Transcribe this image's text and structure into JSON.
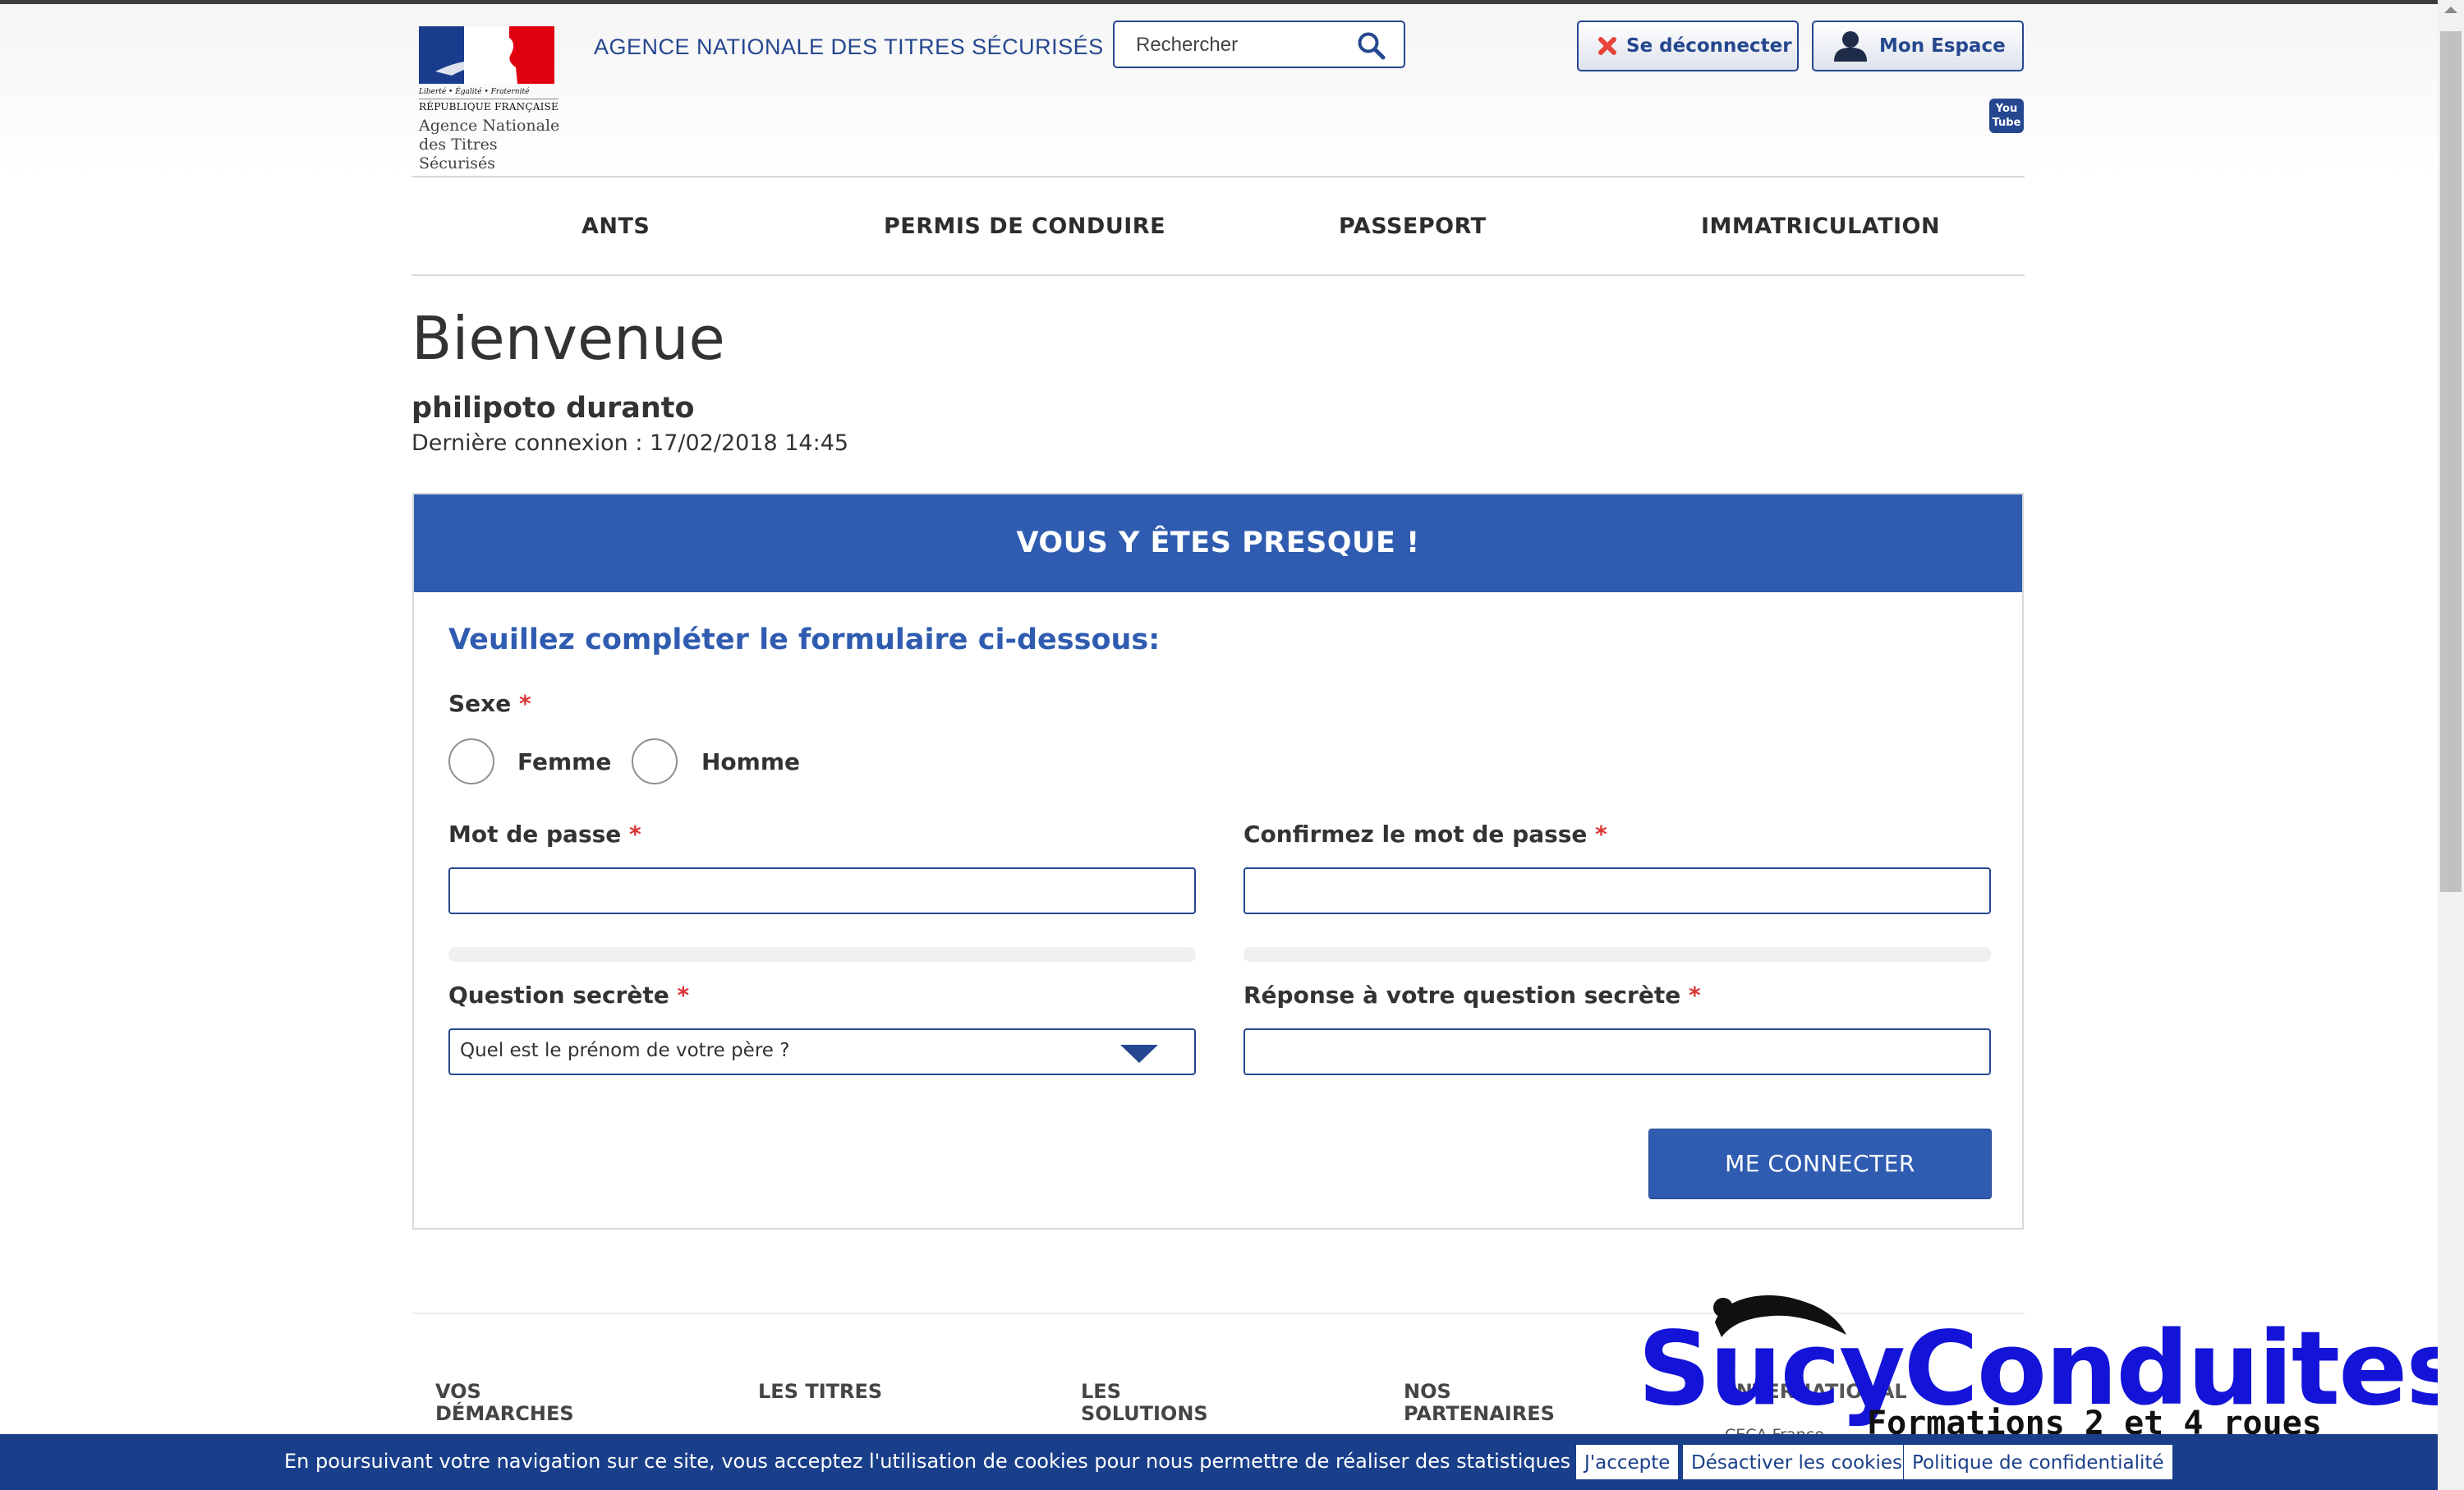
{
  "header": {
    "logo_motto": "Liberté • Égalité • Fraternité",
    "logo_republic": "RÉPUBLIQUE FRANÇAISE",
    "logo_agency": "Agence Nationale des Titres Sécurisés",
    "site_title": "AGENCE NATIONALE DES TITRES SÉCURISÉS",
    "search_placeholder": "Rechercher",
    "logout_label": "Se déconnecter",
    "account_label": "Mon Espace",
    "youtube_label": "You Tube"
  },
  "nav": {
    "items": [
      {
        "label": "ANTS"
      },
      {
        "label": "PERMIS DE CONDUIRE"
      },
      {
        "label": "PASSEPORT"
      },
      {
        "label": "IMMATRICULATION"
      }
    ]
  },
  "welcome": {
    "title": "Bienvenue",
    "username": "philipoto duranto",
    "last_login": "Dernière connexion : 17/02/2018 14:45"
  },
  "form": {
    "banner": "VOUS Y ÊTES PRESQUE !",
    "heading": "Veuillez compléter le formulaire ci-dessous:",
    "required_mark": "*",
    "sex_label": "Sexe",
    "sex_options": [
      "Femme",
      "Homme"
    ],
    "password_label": "Mot de passe",
    "password_value": "",
    "confirm_label": "Confirmez le mot de passe",
    "confirm_value": "",
    "question_label": "Question secrète",
    "question_selected": "Quel est le prénom de votre père ?",
    "answer_label": "Réponse à votre question secrète",
    "answer_value": "",
    "submit_label": "ME CONNECTER"
  },
  "footer": {
    "columns": [
      "VOS DÉMARCHES",
      "LES TITRES",
      "LES SOLUTIONS",
      "NOS PARTENAIRES",
      "INTERNATIONAL"
    ],
    "partial_text": "CECA France"
  },
  "watermark": {
    "brand": "SucyConduites",
    "tagline": "Formations 2 et 4 roues"
  },
  "cookie_bar": {
    "text": "En poursuivant votre navigation sur ce site, vous acceptez l'utilisation de cookies pour nous permettre de réaliser des statistiques de visites.",
    "accept": "J'accepte",
    "disable": "Désactiver les cookies",
    "policy": "Politique de confidentialité"
  },
  "colors": {
    "brand_blue": "#2f5cb0",
    "dark_blue": "#25478f",
    "required_red": "#dd3333",
    "cookie_bg": "#1a3f8a",
    "watermark_blue": "#1413d8"
  },
  "icons": {
    "search": "search-icon",
    "logout": "close-x-icon",
    "account": "user-icon",
    "youtube": "youtube-icon",
    "select": "chevron-down-icon"
  }
}
